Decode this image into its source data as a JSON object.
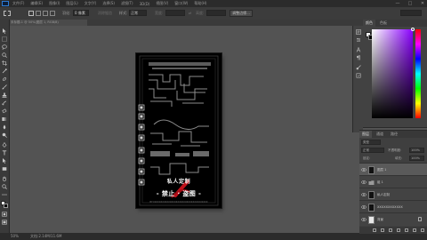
{
  "menubar": {
    "menus": [
      "文件(F)",
      "编辑(E)",
      "图像(I)",
      "图层(L)",
      "文字(Y)",
      "选择(S)",
      "滤镜(T)",
      "3D(D)",
      "视图(V)",
      "窗口(W)",
      "帮助(H)"
    ],
    "window_buttons": [
      "—",
      "□",
      "✕"
    ]
  },
  "optionsbar": {
    "feather_label": "羽化:",
    "feather_value": "0 像素",
    "antialias_label": "消除锯齿",
    "style_label": "样式:",
    "style_value": "正常",
    "width_label": "宽度:",
    "height_label": "高度:",
    "refine_button": "调整边缘..."
  },
  "document": {
    "tab_title": "未标题-1 @ 50%(图层 1, RGB/8)",
    "banner_line1": "私人定制",
    "banner_line2": "- 禁止 · 盗图 -",
    "footnote": "BY:XXXXXXXXXXXXXXXXXXXXXXXXXXXXXXXXXXXX"
  },
  "statusbar": {
    "zoom": "50%",
    "doc_info": "文档:2.14M/11.6M"
  },
  "colorpanel": {
    "tabs": [
      "颜色",
      "色板"
    ],
    "foreground": "#ffffff",
    "background": "#000000"
  },
  "layers": {
    "tabs": [
      "图层",
      "通道",
      "路径"
    ],
    "kind_label": "类型",
    "blend_mode": "正常",
    "opacity_label": "不透明度:",
    "opacity_value": "100%",
    "lock_label": "锁定:",
    "fill_label": "填充:",
    "fill_value": "100%",
    "rows": [
      {
        "name": "图层 1",
        "kind": "pixel"
      },
      {
        "name": "组 1",
        "kind": "group"
      },
      {
        "name": "私人定制",
        "kind": "pixel"
      },
      {
        "name": "XXXXXXXXXXXX",
        "kind": "pixel"
      },
      {
        "name": "背景",
        "kind": "pixel"
      }
    ]
  }
}
